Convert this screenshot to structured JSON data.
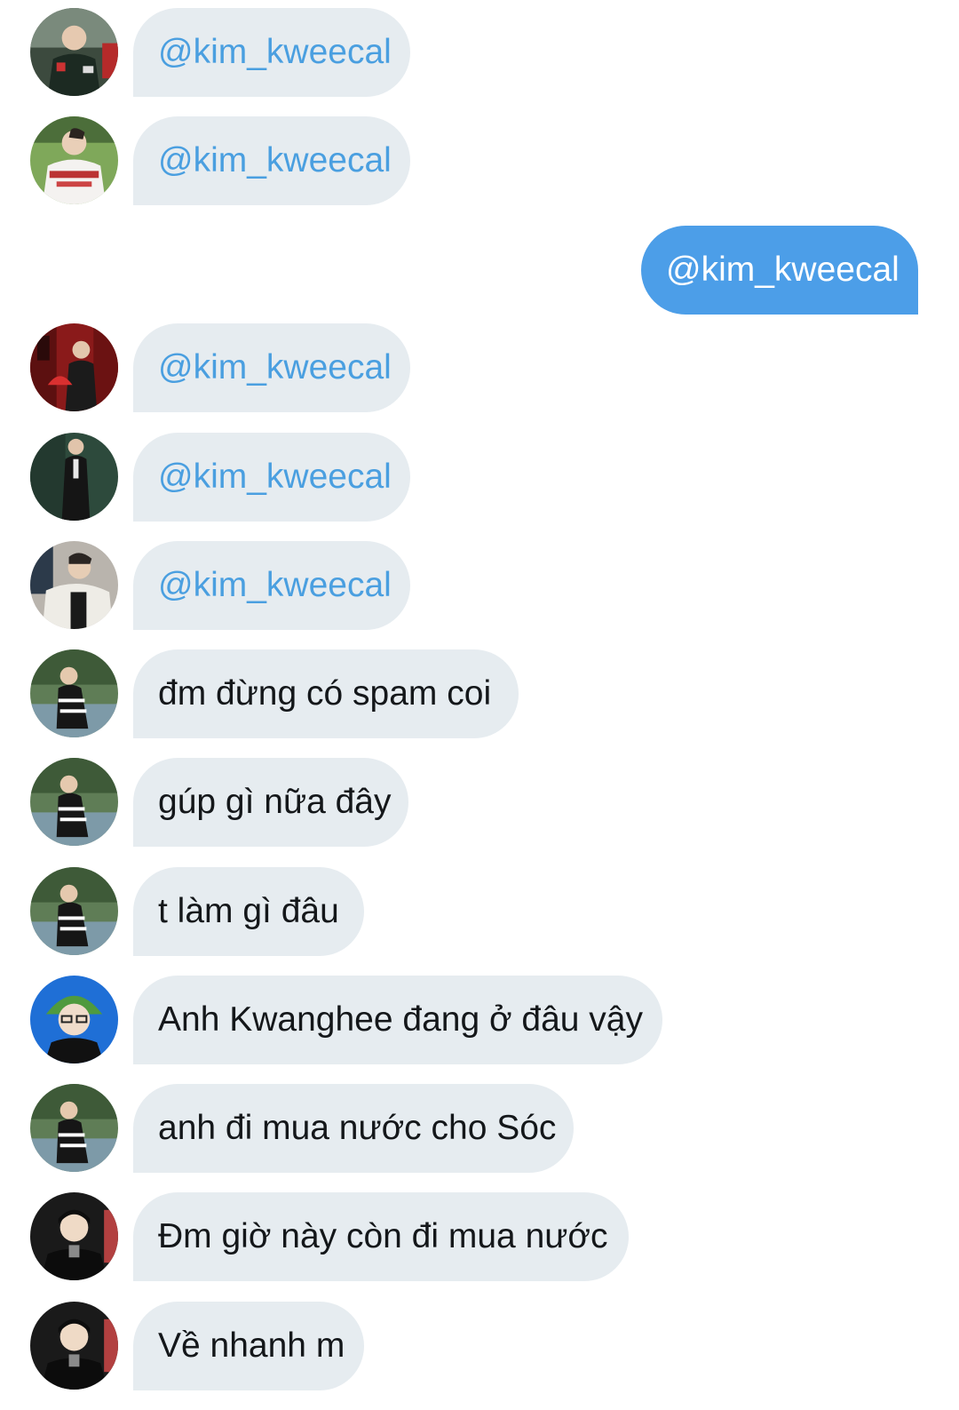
{
  "conversation": {
    "messages": [
      {
        "direction": "incoming",
        "avatar_icon": "user-avatar-icon",
        "text": "@kim_kweecal",
        "is_mention": true
      },
      {
        "direction": "incoming",
        "avatar_icon": "user-avatar-icon",
        "text": "@kim_kweecal",
        "is_mention": true
      },
      {
        "direction": "outgoing",
        "text": "@kim_kweecal",
        "is_mention": true
      },
      {
        "direction": "incoming",
        "avatar_icon": "user-avatar-icon",
        "text": "@kim_kweecal",
        "is_mention": true
      },
      {
        "direction": "incoming",
        "avatar_icon": "user-avatar-icon",
        "text": "@kim_kweecal",
        "is_mention": true
      },
      {
        "direction": "incoming",
        "avatar_icon": "user-avatar-icon",
        "text": "@kim_kweecal",
        "is_mention": true
      },
      {
        "direction": "incoming",
        "avatar_icon": "user-avatar-icon",
        "text": "đm đừng có spam coi",
        "is_mention": false
      },
      {
        "direction": "incoming",
        "avatar_icon": "user-avatar-icon",
        "text": "gúp gì nữa đây",
        "is_mention": false
      },
      {
        "direction": "incoming",
        "avatar_icon": "user-avatar-icon",
        "text": "t làm gì đâu",
        "is_mention": false
      },
      {
        "direction": "incoming",
        "avatar_icon": "user-avatar-icon",
        "text": "Anh Kwanghee đang ở đâu vậy",
        "is_mention": false
      },
      {
        "direction": "incoming",
        "avatar_icon": "user-avatar-icon",
        "text": "anh đi mua nước cho Sóc",
        "is_mention": false
      },
      {
        "direction": "incoming",
        "avatar_icon": "user-avatar-icon",
        "text": "Đm giờ này còn đi mua nước",
        "is_mention": false
      },
      {
        "direction": "incoming",
        "avatar_icon": "user-avatar-icon",
        "text": "Về nhanh m",
        "is_mention": false
      }
    ]
  },
  "colors": {
    "incoming_bubble": "#e6ecf0",
    "outgoing_bubble": "#4c9ee8",
    "mention_text": "#4a9fe0",
    "message_text": "#14171a"
  }
}
